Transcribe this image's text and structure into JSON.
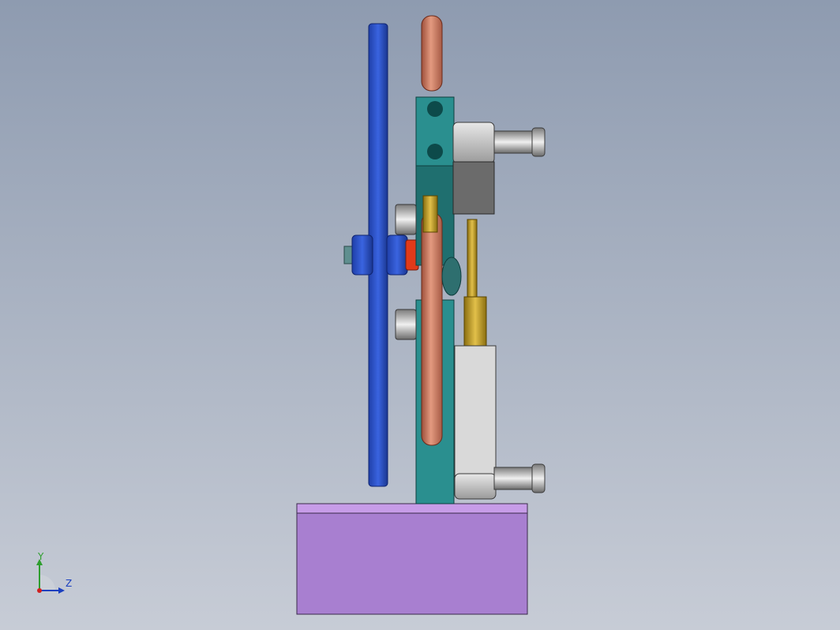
{
  "viewport": {
    "background_top": "#8e9bb0",
    "background_bottom": "#c7ccd6"
  },
  "colors": {
    "flywheel": "#2f55d4",
    "copper_pipe": "#c87a60",
    "teal_frame": "#2a8f8f",
    "brass": "#c9a227",
    "gray_block": "#6b6b6b",
    "light_block": "#d9d9d9",
    "base": "#a87fd0",
    "base_top": "#c79ce8",
    "red_hub": "#e03a1a"
  },
  "triad": {
    "y_label": "Y",
    "z_label": "Z",
    "y_color": "#2e9e2e",
    "z_color": "#1a3fbf",
    "origin_color": "#d02020"
  },
  "icons": [
    "view-triad-icon"
  ]
}
